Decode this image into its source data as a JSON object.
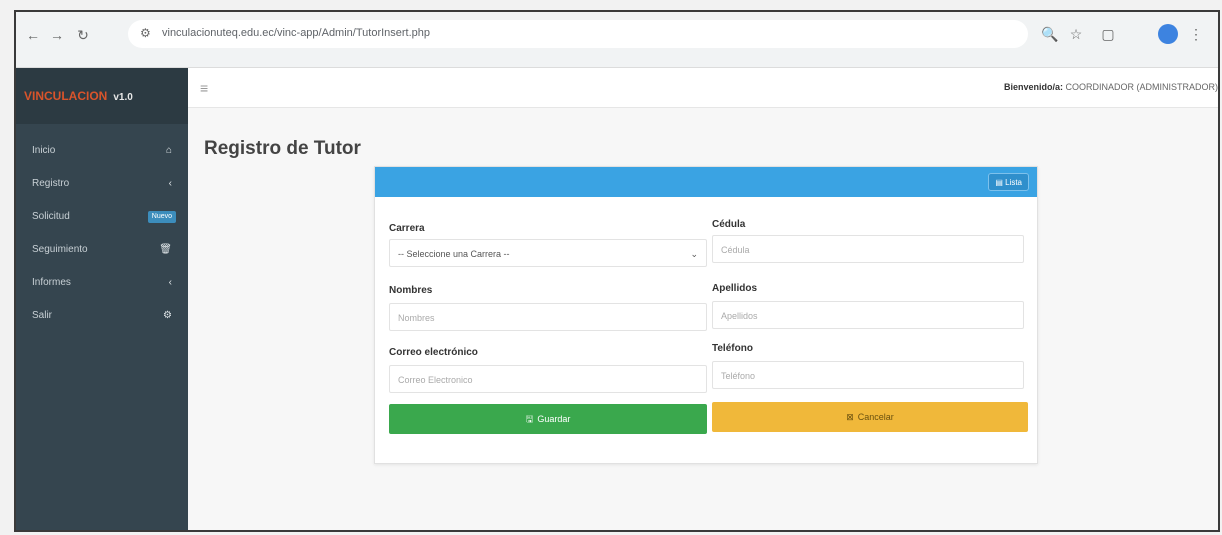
{
  "browser": {
    "url": "vinculacionuteq.edu.ec/vinc-app/Admin/TutorInsert.php",
    "nav": {
      "back": "←",
      "forward": "→",
      "reload": "↻"
    },
    "icons": [
      "zoom-icon",
      "star-icon",
      "sidebar-panel-icon",
      "profile-icon",
      "kebab-menu-icon"
    ]
  },
  "sidebar": {
    "brand": "VINCULACION",
    "version": "v1.0",
    "items": [
      {
        "label": "Inicio",
        "icon": "home-icon"
      },
      {
        "label": "Registro",
        "icon": "chevron-left-icon"
      },
      {
        "label": "Solicitud",
        "badge": "Nuevo"
      },
      {
        "label": "Seguimiento",
        "icon": "trash-icon"
      },
      {
        "label": "Informes",
        "icon": "chevron-left-icon"
      },
      {
        "label": "Salir",
        "icon": "gear-icon"
      }
    ]
  },
  "topbar": {
    "welcome_label": "Bienvenido/a:",
    "user": "COORDINADOR (ADMINISTRADOR)"
  },
  "page": {
    "title": "Registro de Tutor"
  },
  "card": {
    "list_button": "Lista",
    "fields": {
      "carrera": {
        "label": "Carrera",
        "value": "-- Seleccione una Carrera --"
      },
      "cedula": {
        "label": "Cédula",
        "placeholder": "Cédula"
      },
      "nombres": {
        "label": "Nombres",
        "placeholder": "Nombres"
      },
      "apellidos": {
        "label": "Apellidos",
        "placeholder": "Apellidos"
      },
      "correo": {
        "label": "Correo electrónico",
        "placeholder": "Correo Electronico"
      },
      "telefono": {
        "label": "Teléfono",
        "placeholder": "Teléfono"
      }
    },
    "save_label": "Guardar",
    "cancel_label": "Cancelar"
  },
  "colors": {
    "sidebar": "#35454f",
    "header": "#3aa3e3",
    "save": "#3aa84d",
    "cancel": "#f0b83a",
    "brand": "#d9542b"
  }
}
